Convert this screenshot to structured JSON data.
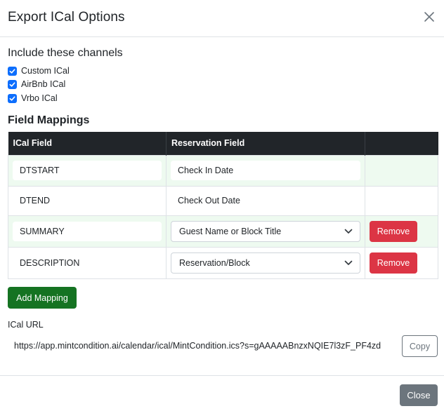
{
  "modal": {
    "title": "Export ICal Options",
    "close_icon": "close-icon"
  },
  "channels": {
    "title": "Include these channels",
    "items": [
      {
        "label": "Custom ICal",
        "checked": true
      },
      {
        "label": "AirBnb ICal",
        "checked": true
      },
      {
        "label": "Vrbo ICal",
        "checked": true
      }
    ]
  },
  "mappings": {
    "title": "Field Mappings",
    "headers": [
      "ICal Field",
      "Reservation Field",
      ""
    ],
    "rows": [
      {
        "ical_field": "DTSTART",
        "reservation_field": "Check In Date",
        "type": "text"
      },
      {
        "ical_field": "DTEND",
        "reservation_field": "Check Out Date",
        "type": "text"
      },
      {
        "ical_field": "SUMMARY",
        "reservation_field": "Guest Name or Block Title",
        "type": "select",
        "action": "Remove"
      },
      {
        "ical_field": "DESCRIPTION",
        "reservation_field": "Reservation/Block",
        "type": "select",
        "action": "Remove"
      }
    ],
    "add_button": "Add Mapping"
  },
  "ical_url": {
    "label": "ICal URL",
    "value": "https://app.mintcondition.ai/calendar/ical/MintCondition.ics?s=gAAAAABnzxNQIE7l3zF_PF4zd",
    "copy_button": "Copy"
  },
  "footer": {
    "close_button": "Close"
  },
  "colors": {
    "primary": "#0d6efd",
    "success": "#157322",
    "danger": "#dc3545",
    "secondary": "#6c757d",
    "table_header": "#212529"
  }
}
